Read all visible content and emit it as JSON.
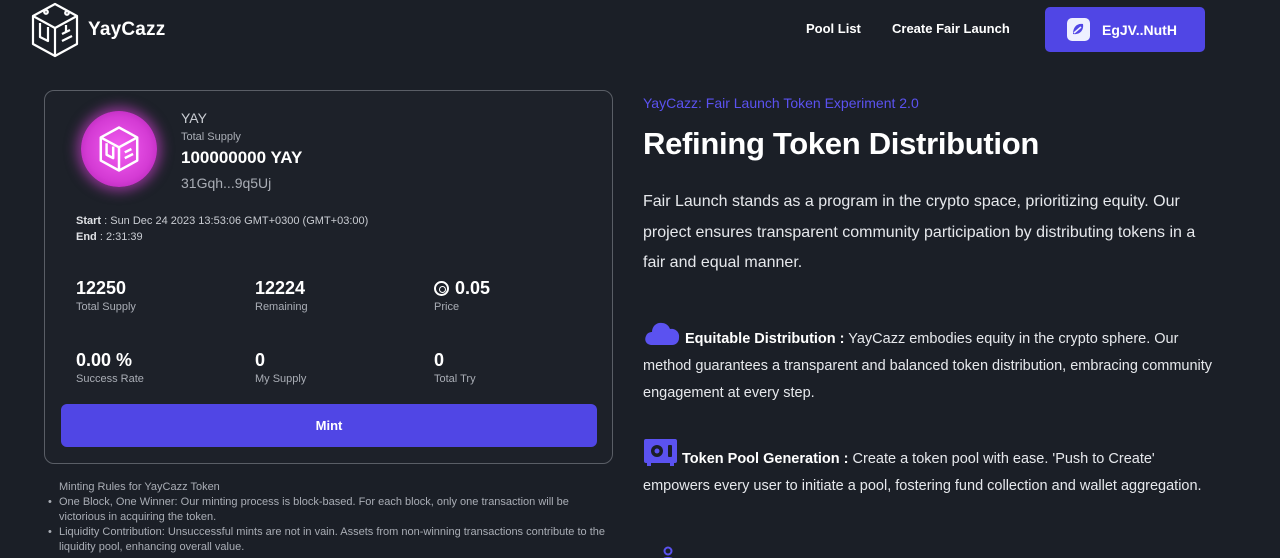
{
  "header": {
    "brand": "YayCazz",
    "nav": {
      "pool_list": "Pool List",
      "create_fair_launch": "Create Fair Launch"
    },
    "wallet_label": "EgJV..NutH"
  },
  "token": {
    "symbol": "YAY",
    "total_supply_label": "Total Supply",
    "total_supply_value": "100000000 YAY",
    "address": "31Gqh...9q5Uj",
    "start_label": "Start",
    "start_value": " : Sun Dec 24 2023 13:53:06 GMT+0300 (GMT+03:00)",
    "end_label": "End",
    "end_value": " : 2:31:39"
  },
  "stats": [
    {
      "value": "12250",
      "label": "Total Supply"
    },
    {
      "value": "12224",
      "label": "Remaining"
    },
    {
      "value": "0.05",
      "label": "Price",
      "icon": "coin-icon"
    },
    {
      "value": "0.00 %",
      "label": "Success Rate"
    },
    {
      "value": "0",
      "label": "My Supply"
    },
    {
      "value": "0",
      "label": "Total Try"
    }
  ],
  "mint_label": "Mint",
  "rules": {
    "title": "Minting Rules for YayCazz Token",
    "items": [
      "One Block, One Winner: Our minting process is block-based. For each block, only one transaction will be victorious in acquiring the token.",
      "Liquidity Contribution: Unsuccessful mints are not in vain. Assets from non-winning transactions contribute to the liquidity pool, enhancing overall value."
    ]
  },
  "info": {
    "kicker": "YayCazz: Fair Launch Token Experiment 2.0",
    "headline": "Refining Token Distribution",
    "intro": "Fair Launch stands as a program in the crypto space, prioritizing equity. Our project ensures transparent community participation by distributing tokens in a fair and equal manner.",
    "features": [
      {
        "icon": "cloud-icon",
        "title": "Equitable Distribution :",
        "text": " YayCazz embodies equity in the crypto sphere. Our method guarantees a transparent and balanced token distribution, embracing community engagement at every step."
      },
      {
        "icon": "safe-icon",
        "title": "Token Pool Generation :",
        "text": " Create a token pool with ease. 'Push to Create' empowers every user to initiate a pool, fostering fund collection and wallet aggregation."
      }
    ]
  },
  "colors": {
    "accent": "#5046e5",
    "kicker": "#5b52f0",
    "background": "#1b1f27",
    "token_glow": "#e646e6"
  }
}
